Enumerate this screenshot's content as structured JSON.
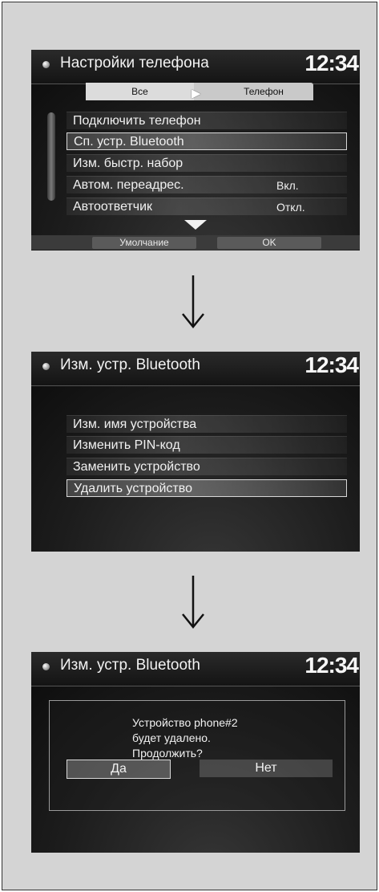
{
  "clock": "12:34",
  "screen1": {
    "title": "Настройки телефона",
    "tabs": {
      "all": "Все",
      "phone": "Телефон"
    },
    "items": [
      {
        "label": "Подключить телефон",
        "value": ""
      },
      {
        "label": "Сп. устр. Bluetooth",
        "value": "",
        "selected": true
      },
      {
        "label": "Изм. быстр. набор",
        "value": ""
      },
      {
        "label": "Автом. переадрес.",
        "value": "Вкл."
      },
      {
        "label": "Автоответчик",
        "value": "Откл."
      }
    ],
    "softkeys": {
      "default": "Умолчание",
      "ok": "OK"
    }
  },
  "screen2": {
    "title": "Изм. устр. Bluetooth",
    "items": [
      {
        "label": "Изм. имя устройства"
      },
      {
        "label": "Изменить PIN-код"
      },
      {
        "label": "Заменить устройство"
      },
      {
        "label": "Удалить устройство",
        "selected": true
      }
    ]
  },
  "screen3": {
    "title": "Изм. устр. Bluetooth",
    "message": [
      "Устройство phone#2",
      "будет удалено.",
      "Продолжить?"
    ],
    "buttons": {
      "yes": "Да",
      "no": "Нет"
    }
  }
}
